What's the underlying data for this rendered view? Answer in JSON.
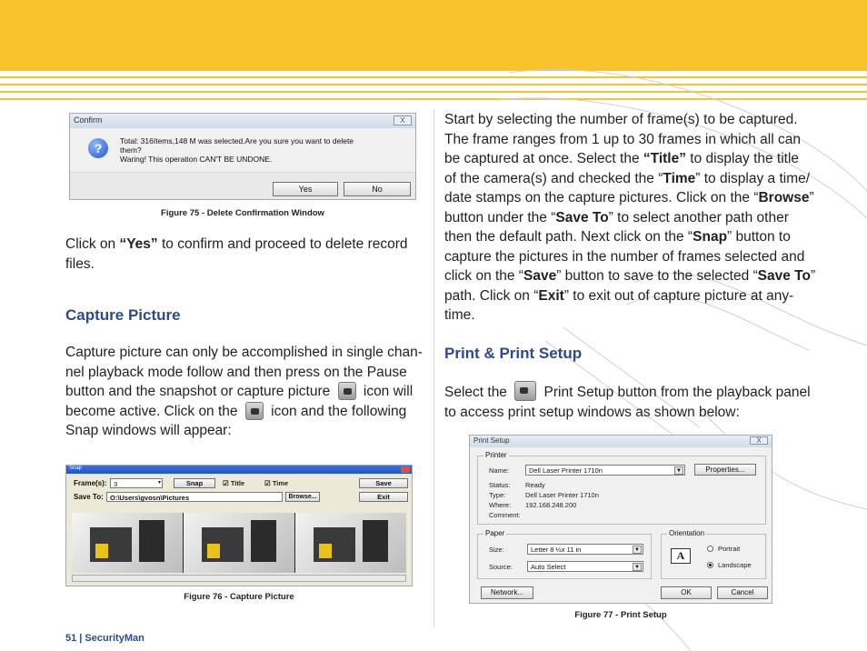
{
  "confirm_dialog": {
    "title": "Confirm",
    "message_line1": "Total: 316Items,148 M was selected.Are you sure you want to delete",
    "message_line2": "them?",
    "message_line3": "Waring! This operation CAN'T BE UNDONE.",
    "yes_label": "Yes",
    "no_label": "No",
    "close_glyph": "X",
    "icon": "question-icon"
  },
  "fig75_caption": "Figure 75 - Delete Confirmation Window",
  "left": {
    "p1_pre": "Click on ",
    "p1_bold": "“Yes”",
    "p1_line1_post": " to confirm and proceed to delete record",
    "p1_line2": "files.",
    "heading_capture": "Capture Picture",
    "p2_line1": "Capture picture can only be accomplished in single chan-",
    "p2_line2": "nel playback mode follow and then press on the Pause",
    "p2_line3a": "button and the snapshot or capture picture ",
    "p2_line3b": " icon will",
    "p2_line4a": "become active.  Click on the ",
    "p2_line4b": " icon and the following",
    "p2_line5": "Snap windows will appear:"
  },
  "snap_window": {
    "title": "Snap",
    "frames_label": "Frame(s):",
    "frames_value": "3",
    "snap_label": "Snap",
    "title_check": "Title",
    "time_check": "Time",
    "save_label": "Save",
    "exit_label": "Exit",
    "saveto_label": "Save To:",
    "saveto_value": "O:\\Users\\gvosn\\Pictures",
    "browse_label": "Browse..."
  },
  "fig76_caption": "Figure 76 - Capture Picture",
  "right": {
    "l1": "Start by selecting the number of frame(s) to be captured.",
    "l2": "The frame ranges from 1 up to 30 frames in which all can",
    "l3a": "be captured at once.  Select the ",
    "l3b": "“Title”",
    "l3c": " to display the title",
    "l4a": "of the camera(s) and checked the “",
    "l4b": "Time",
    "l4c": "” to display a time/",
    "l5a": "date stamps on the capture pictures. Click on the “",
    "l5b": "Browse",
    "l5c": "”",
    "l6a": "button under the “",
    "l6b": "Save To",
    "l6c": "” to select another path other",
    "l7a": "then the default path.  Next click on the “",
    "l7b": "Snap",
    "l7c": "” button to",
    "l8": "capture the pictures in the number of frames selected and",
    "l9a": "click on the “",
    "l9b": "Save",
    "l9c": "” button to save to the selected “",
    "l9d": "Save To",
    "l9e": "”",
    "l10a": "path.  Click on “",
    "l10b": "Exit",
    "l10c": "” to exit out of capture picture at any-",
    "l11": "time.",
    "heading_print": "Print & Print Setup",
    "p_print_a": "Select the ",
    "p_print_b": " Print Setup button from the playback panel",
    "p_print_line2": "to access print setup windows as shown below:"
  },
  "print_setup": {
    "title": "Print Setup",
    "printer_group": "Printer",
    "name_label": "Name:",
    "name_value": "Dell Laser Printer 1710n",
    "properties_label": "Properties...",
    "status_label": "Status:",
    "status_value": "Ready",
    "type_label": "Type:",
    "type_value": "Dell Laser Printer 1710n",
    "where_label": "Where:",
    "where_value": "192.168.248.200",
    "comment_label": "Comment:",
    "paper_group": "Paper",
    "size_label": "Size:",
    "size_value": "Letter 8 ½x 11 in",
    "source_label": "Source:",
    "source_value": "Auto Select",
    "orientation_group": "Orientation",
    "portrait_label": "Portrait",
    "landscape_label": "Landscape",
    "orientation_selected": "Landscape",
    "network_label": "Network...",
    "ok_label": "OK",
    "cancel_label": "Cancel"
  },
  "fig77_caption": "Figure 77 - Print Setup",
  "footer": "51  |  SecurityMan"
}
